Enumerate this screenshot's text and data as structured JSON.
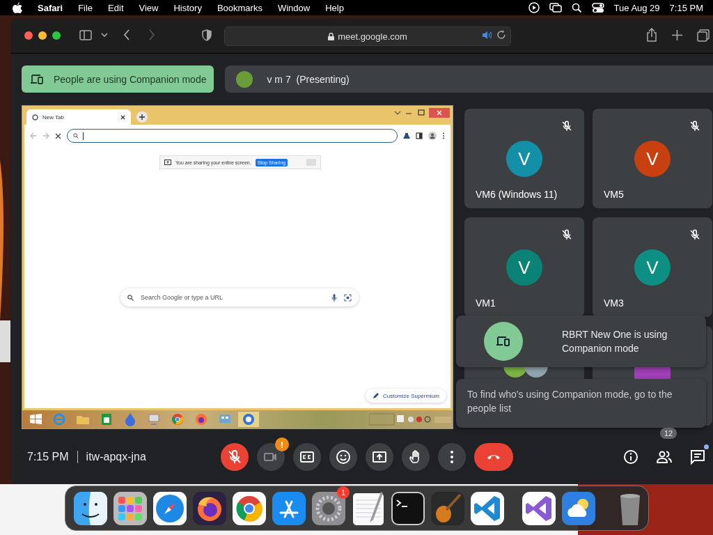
{
  "menu_bar": {
    "app": "Safari",
    "menus": [
      "File",
      "Edit",
      "View",
      "History",
      "Bookmarks",
      "Window",
      "Help"
    ],
    "date": "Tue Aug 29",
    "time": "7:15 PM"
  },
  "browser": {
    "url": "meet.google.com"
  },
  "meeting": {
    "companion_chip": "People are using Companion mode",
    "presenter": {
      "name": "v m 7",
      "status": "(Presenting)",
      "color": "#6a9c3a"
    },
    "shared_screen": {
      "tab_title": "New Tab",
      "share_notice": "You are sharing your entire screen.",
      "stop_button": "Stop Sharing",
      "search_placeholder": "Search Google or type a URL",
      "customize_button": "Customize Supermium"
    },
    "tiles": [
      {
        "kind": "person",
        "initial": "V",
        "name": "VM6 (Windows 11)",
        "color": "#1390a8",
        "muted": true
      },
      {
        "kind": "person",
        "initial": "V",
        "name": "VM5",
        "color": "#c8400f",
        "muted": true
      },
      {
        "kind": "person",
        "initial": "V",
        "name": "VM1",
        "color": "#0b8276",
        "muted": true
      },
      {
        "kind": "person",
        "initial": "V",
        "name": "VM3",
        "color": "#0e8f84",
        "muted": true
      },
      {
        "kind": "group",
        "avatars": [
          {
            "color": "#7cb342"
          },
          {
            "color": "#90a4ae"
          }
        ]
      },
      {
        "kind": "partial",
        "color": "#a13fb8"
      }
    ],
    "notification": "RBRT New One is using Companion mode",
    "tooltip": "To find who's using Companion mode, go to the people list",
    "time": "7:15 PM",
    "meeting_code": "itw-apqx-jna",
    "controls": [
      {
        "kind": "mic",
        "on": false
      },
      {
        "kind": "camera",
        "alert": "!"
      },
      {
        "kind": "captions"
      },
      {
        "kind": "emoji"
      },
      {
        "kind": "present"
      },
      {
        "kind": "hand"
      },
      {
        "kind": "more"
      },
      {
        "kind": "leave"
      }
    ],
    "people_count": "12"
  },
  "dock": [
    {
      "kind": "finder"
    },
    {
      "kind": "launchpad"
    },
    {
      "kind": "safari"
    },
    {
      "kind": "firefox"
    },
    {
      "kind": "chrome"
    },
    {
      "kind": "appstore"
    },
    {
      "kind": "settings",
      "badge": "1"
    },
    {
      "kind": "textedit"
    },
    {
      "kind": "terminal"
    },
    {
      "kind": "guitar"
    },
    {
      "kind": "vscode"
    },
    {
      "kind": "separator"
    },
    {
      "kind": "visualstudio"
    },
    {
      "kind": "weather"
    },
    {
      "kind": "separator"
    },
    {
      "kind": "trash"
    }
  ]
}
